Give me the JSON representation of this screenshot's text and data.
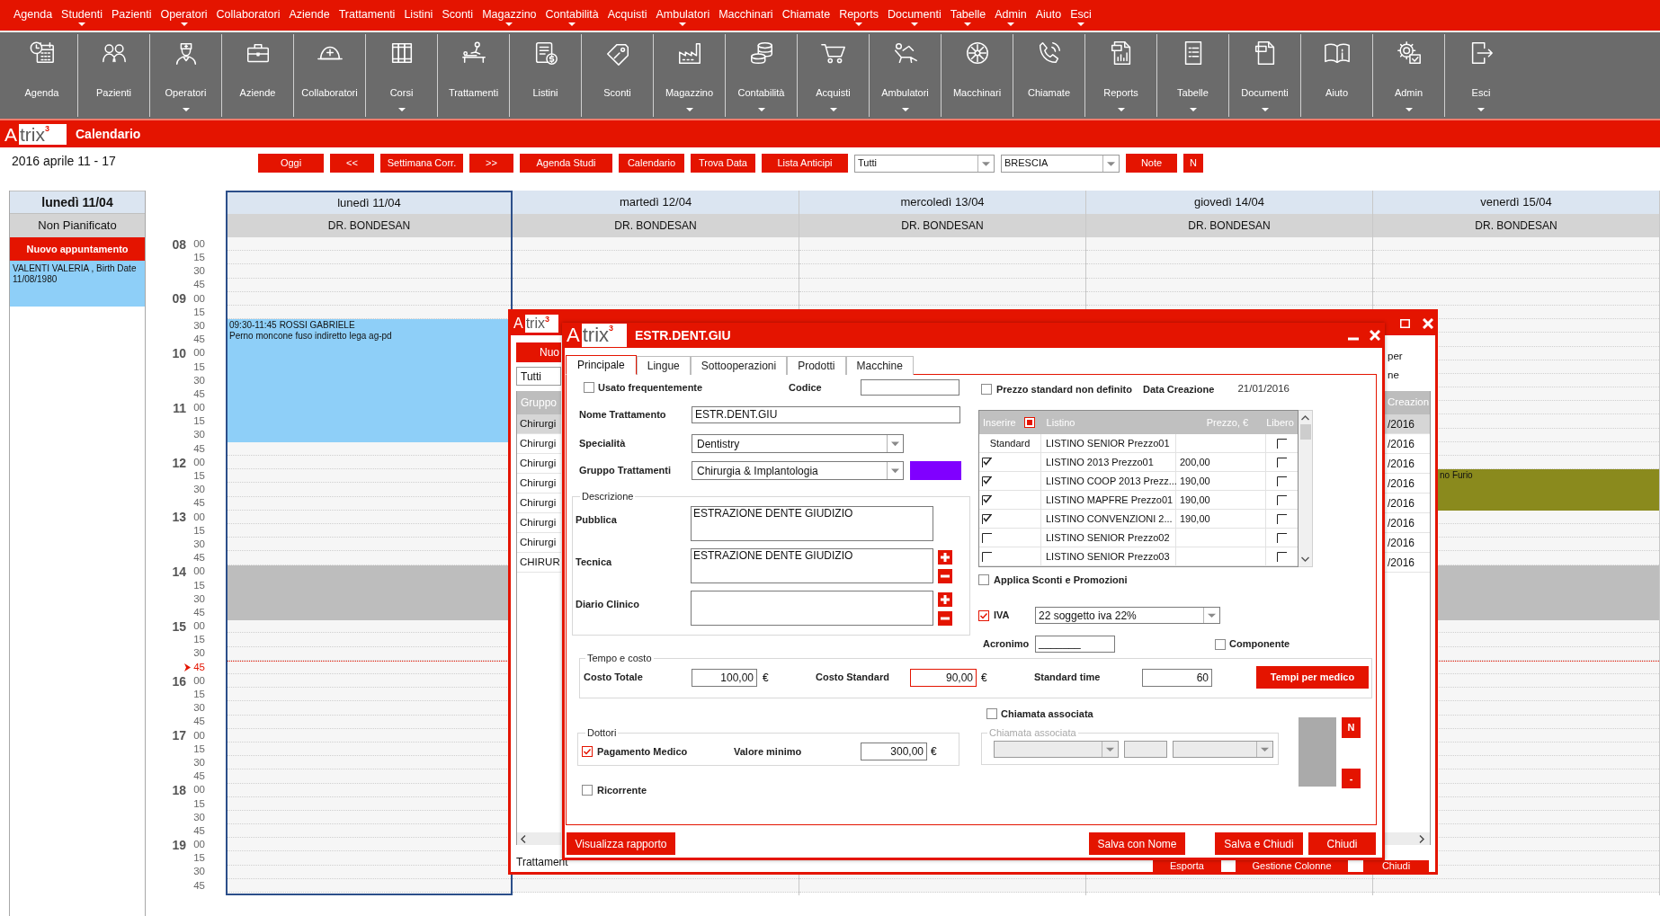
{
  "menu_bar": [
    {
      "label": "Agenda",
      "dropdown": false
    },
    {
      "label": "Studenti",
      "dropdown": true
    },
    {
      "label": "Pazienti",
      "dropdown": false
    },
    {
      "label": "Operatori",
      "dropdown": true
    },
    {
      "label": "Collaboratori",
      "dropdown": false
    },
    {
      "label": "Aziende",
      "dropdown": false
    },
    {
      "label": "Trattamenti",
      "dropdown": false
    },
    {
      "label": "Listini",
      "dropdown": false
    },
    {
      "label": "Sconti",
      "dropdown": false
    },
    {
      "label": "Magazzino",
      "dropdown": true
    },
    {
      "label": "Contabilità",
      "dropdown": true
    },
    {
      "label": "Acquisti",
      "dropdown": false
    },
    {
      "label": "Ambulatori",
      "dropdown": true
    },
    {
      "label": "Macchinari",
      "dropdown": false
    },
    {
      "label": "Chiamate",
      "dropdown": false
    },
    {
      "label": "Reports",
      "dropdown": true
    },
    {
      "label": "Documenti",
      "dropdown": true
    },
    {
      "label": "Tabelle",
      "dropdown": true
    },
    {
      "label": "Admin",
      "dropdown": true
    },
    {
      "label": "Aiuto",
      "dropdown": false
    },
    {
      "label": "Esci",
      "dropdown": true
    }
  ],
  "toolbar": [
    {
      "label": "Agenda",
      "dropdown": false
    },
    {
      "label": "Pazienti",
      "dropdown": false
    },
    {
      "label": "Operatori",
      "dropdown": true
    },
    {
      "label": "Aziende",
      "dropdown": false
    },
    {
      "label": "Collaboratori",
      "dropdown": false
    },
    {
      "label": "Corsi",
      "dropdown": true
    },
    {
      "label": "Trattamenti",
      "dropdown": false
    },
    {
      "label": "Listini",
      "dropdown": false
    },
    {
      "label": "Sconti",
      "dropdown": false
    },
    {
      "label": "Magazzino",
      "dropdown": true
    },
    {
      "label": "Contabilità",
      "dropdown": true
    },
    {
      "label": "Acquisti",
      "dropdown": true
    },
    {
      "label": "Ambulatori",
      "dropdown": true
    },
    {
      "label": "Macchinari",
      "dropdown": false
    },
    {
      "label": "Chiamate",
      "dropdown": false
    },
    {
      "label": "Reports",
      "dropdown": true
    },
    {
      "label": "Tabelle",
      "dropdown": true
    },
    {
      "label": "Documenti",
      "dropdown": true
    },
    {
      "label": "Aiuto",
      "dropdown": false
    },
    {
      "label": "Admin",
      "dropdown": true
    },
    {
      "label": "Esci",
      "dropdown": true
    }
  ],
  "module_bar": {
    "logo": {
      "initial": "A",
      "rest": "trix",
      "superscript": "3"
    },
    "title": "Calendario"
  },
  "week_bar": {
    "date_range": "2016 aprile 11 - 17",
    "controls": [
      {
        "kind": "button",
        "label": "Oggi"
      },
      {
        "kind": "button",
        "label": "<<"
      },
      {
        "kind": "button",
        "label": "Settimana Corr."
      },
      {
        "kind": "button",
        "label": ">>"
      },
      {
        "kind": "button",
        "label": "Agenda Studi"
      },
      {
        "kind": "button",
        "label": "Calendario"
      },
      {
        "kind": "button",
        "label": "Trova Data"
      },
      {
        "kind": "button",
        "label": "Lista Anticipi"
      },
      {
        "kind": "dropdown",
        "value": "Tutti"
      },
      {
        "kind": "dropdown",
        "value": "BRESCIA"
      },
      {
        "kind": "button",
        "label": "Note"
      },
      {
        "kind": "button",
        "label": "N"
      }
    ]
  },
  "unplanned": {
    "day": "lunedì 11/04",
    "title": "Non Pianificato",
    "new_button": "Nuovo appuntamento",
    "appointments": [
      {
        "text": "VALENTI VALERIA , Birth Date 11/08/1980"
      }
    ]
  },
  "time_axis": [
    {
      "hour": "08",
      "blocked": false,
      "slots": [
        {
          "minute": "00",
          "current": false
        },
        {
          "minute": "15",
          "current": false
        },
        {
          "minute": "30",
          "current": false
        },
        {
          "minute": "45",
          "current": false
        }
      ]
    },
    {
      "hour": "09",
      "blocked": false,
      "slots": [
        {
          "minute": "00",
          "current": false
        },
        {
          "minute": "15",
          "current": false
        },
        {
          "minute": "30",
          "current": false
        },
        {
          "minute": "45",
          "current": false
        }
      ]
    },
    {
      "hour": "10",
      "blocked": false,
      "slots": [
        {
          "minute": "00",
          "current": false
        },
        {
          "minute": "15",
          "current": false
        },
        {
          "minute": "30",
          "current": false
        },
        {
          "minute": "45",
          "current": false
        }
      ]
    },
    {
      "hour": "11",
      "blocked": false,
      "slots": [
        {
          "minute": "00",
          "current": false
        },
        {
          "minute": "15",
          "current": false
        },
        {
          "minute": "30",
          "current": false
        },
        {
          "minute": "45",
          "current": false
        }
      ]
    },
    {
      "hour": "12",
      "blocked": false,
      "slots": [
        {
          "minute": "00",
          "current": false
        },
        {
          "minute": "15",
          "current": false
        },
        {
          "minute": "30",
          "current": false
        },
        {
          "minute": "45",
          "current": false
        }
      ]
    },
    {
      "hour": "13",
      "blocked": false,
      "slots": [
        {
          "minute": "00",
          "current": false
        },
        {
          "minute": "15",
          "current": false
        },
        {
          "minute": "30",
          "current": false
        },
        {
          "minute": "45",
          "current": false
        }
      ]
    },
    {
      "hour": "14",
      "blocked": true,
      "slots": [
        {
          "minute": "00",
          "current": false
        },
        {
          "minute": "15",
          "current": false
        },
        {
          "minute": "30",
          "current": false
        },
        {
          "minute": "45",
          "current": false
        }
      ]
    },
    {
      "hour": "15",
      "blocked": false,
      "slots": [
        {
          "minute": "00",
          "current": false
        },
        {
          "minute": "15",
          "current": false
        },
        {
          "minute": "30",
          "current": false
        },
        {
          "minute": "45",
          "current": true
        }
      ]
    },
    {
      "hour": "16",
      "blocked": false,
      "slots": [
        {
          "minute": "00",
          "current": false
        },
        {
          "minute": "15",
          "current": false
        },
        {
          "minute": "30",
          "current": false
        },
        {
          "minute": "45",
          "current": false
        }
      ]
    },
    {
      "hour": "17",
      "blocked": false,
      "slots": [
        {
          "minute": "00",
          "current": false
        },
        {
          "minute": "15",
          "current": false
        },
        {
          "minute": "30",
          "current": false
        },
        {
          "minute": "45",
          "current": false
        }
      ]
    },
    {
      "hour": "18",
      "blocked": false,
      "slots": [
        {
          "minute": "00",
          "current": false
        },
        {
          "minute": "15",
          "current": false
        },
        {
          "minute": "30",
          "current": false
        },
        {
          "minute": "45",
          "current": false
        }
      ]
    },
    {
      "hour": "19",
      "blocked": false,
      "slots": [
        {
          "minute": "00",
          "current": false
        },
        {
          "minute": "15",
          "current": false
        },
        {
          "minute": "30",
          "current": false
        },
        {
          "minute": "45",
          "current": false
        }
      ]
    }
  ],
  "days": [
    {
      "label": "lunedì 11/04",
      "doctor": "DR. BONDESAN",
      "selected": true,
      "appointments": [
        {
          "time": "09:30-11:45",
          "title": "ROSSI GABRIELE",
          "note": "Perno moncone fuso indiretto lega ag-pd",
          "color": "#8ecff8"
        }
      ]
    },
    {
      "label": "martedì 12/04",
      "doctor": "DR. BONDESAN",
      "selected": false
    },
    {
      "label": "mercoledì 13/04",
      "doctor": "DR. BONDESAN",
      "selected": false
    },
    {
      "label": "giovedì 14/04",
      "doctor": "DR. BONDESAN",
      "selected": false
    },
    {
      "label": "venerdì 15/04",
      "doctor": "DR. BONDESAN",
      "selected": false,
      "appointments": [
        {
          "title": "no Furio",
          "color": "#8a8a1d"
        }
      ]
    }
  ],
  "background_window": {
    "logo": {
      "initial": "A",
      "rest": "trix",
      "superscript": "3"
    },
    "new_button": "Nuo",
    "filter": "Tutti",
    "side_labels": [
      "per",
      "ne"
    ],
    "table": {
      "columns": [
        "Gruppo",
        "Creazion"
      ],
      "rows": [
        {
          "cells": [
            "Chirurgi",
            "/2016"
          ],
          "selected": true
        },
        {
          "cells": [
            "Chirurgi",
            "/2016"
          ],
          "selected": false
        },
        {
          "cells": [
            "Chirurgi",
            "/2016"
          ],
          "selected": false
        },
        {
          "cells": [
            "Chirurgi",
            "/2016"
          ],
          "selected": false
        },
        {
          "cells": [
            "Chirurgi",
            "/2016"
          ],
          "selected": false
        },
        {
          "cells": [
            "Chirurgi",
            "/2016"
          ],
          "selected": false
        },
        {
          "cells": [
            "Chirurgi",
            "/2016"
          ],
          "selected": false
        },
        {
          "cells": [
            "CHIRUR",
            "/2016"
          ],
          "selected": false
        }
      ]
    },
    "footer_label": "Trattament",
    "buttons": [
      "Esporta",
      "Gestione Colonne",
      "Chiudi"
    ]
  },
  "dialog": {
    "logo": {
      "initial": "A",
      "rest": "trix",
      "superscript": "3"
    },
    "title": "ESTR.DENT.GIU",
    "tabs": [
      {
        "label": "Principale",
        "selected": true
      },
      {
        "label": "Lingue",
        "selected": false
      },
      {
        "label": "Sottooperazioni",
        "selected": false
      },
      {
        "label": "Prodotti",
        "selected": false
      },
      {
        "label": "Macchine",
        "selected": false
      }
    ],
    "usage": {
      "label": "Usato frequentemente",
      "checked": false
    },
    "code": {
      "label": "Codice"
    },
    "name": {
      "label": "Nome Trattamento",
      "value": "ESTR.DENT.GIU"
    },
    "specialty": {
      "label": "Specialità",
      "value": "Dentistry"
    },
    "group": {
      "label": "Gruppo Trattamenti",
      "value": "Chirurgia & Implantologia",
      "color": "#8000ff"
    },
    "description": {
      "title": "Descrizione",
      "fields": [
        {
          "label": "Pubblica",
          "value": "ESTRAZIONE DENTE GIUDIZIO",
          "add_remove": false
        },
        {
          "label": "Tecnica",
          "value": "ESTRAZIONE DENTE GIUDIZIO",
          "add_remove": true
        },
        {
          "label": "Diario Clinico",
          "add_remove": true
        }
      ]
    },
    "undefined_price": {
      "label": "Prezzo standard non definito",
      "checked": false
    },
    "creation_date": {
      "label": "Data Creazione",
      "value": "21/01/2016"
    },
    "price_lists": {
      "columns": [
        "Inserire",
        "Listino",
        "Prezzo, €",
        "Libero"
      ],
      "select_all_partial": true,
      "rows": [
        {
          "kind": "standard",
          "insert": "Standard",
          "list": "LISTINO SENIOR Prezzo01",
          "free": false
        },
        {
          "kind": "checkbox",
          "inserted": true,
          "list": "LISTINO 2013 Prezzo01",
          "price": "200,00",
          "free": false
        },
        {
          "kind": "checkbox",
          "inserted": true,
          "list": "LISTINO COOP 2013 Prezz...",
          "price": "190,00",
          "free": false
        },
        {
          "kind": "checkbox",
          "inserted": true,
          "list": "LISTINO MAPFRE Prezzo01",
          "price": "190,00",
          "free": false
        },
        {
          "kind": "checkbox",
          "inserted": true,
          "list": "LISTINO CONVENZIONI 2...",
          "price": "190,00",
          "free": false
        },
        {
          "kind": "checkbox",
          "inserted": false,
          "list": "LISTINO SENIOR Prezzo02",
          "free": false
        },
        {
          "kind": "checkbox",
          "inserted": false,
          "list": "LISTINO SENIOR Prezzo03",
          "free": false
        }
      ]
    },
    "discounts": {
      "label": "Applica Sconti e Promozioni",
      "checked": false
    },
    "vat": {
      "label": "IVA",
      "checked": true,
      "value": "22 soggetto iva 22%"
    },
    "acronym": {
      "label": "Acronimo",
      "value": "_______"
    },
    "component": {
      "label": "Componente",
      "checked": false
    },
    "time_cost": {
      "title": "Tempo e costo",
      "total": {
        "label": "Costo Totale",
        "value": "100,00",
        "unit": "€"
      },
      "standard": {
        "label": "Costo Standard",
        "value": "90,00",
        "unit": "€",
        "focused": true
      },
      "time": {
        "label": "Standard time",
        "value": "60"
      },
      "button": "Tempi per medico"
    },
    "doctors": {
      "title": "Dottori",
      "payment": {
        "label": "Pagamento Medico",
        "checked": true
      },
      "minimum": {
        "label": "Valore minimo",
        "value": "300,00",
        "unit": "€"
      }
    },
    "recurring": {
      "label": "Ricorrente",
      "checked": false
    },
    "call": {
      "label": "Chiamata associata",
      "checked": false,
      "group_title": "Chiamata associata",
      "disabled": true
    },
    "side_buttons": [
      "N",
      "-"
    ],
    "report_button": "Visualizza rapporto",
    "footer_buttons": [
      "Salva con Nome",
      "Salva e Chiudi",
      "Chiudi"
    ]
  }
}
